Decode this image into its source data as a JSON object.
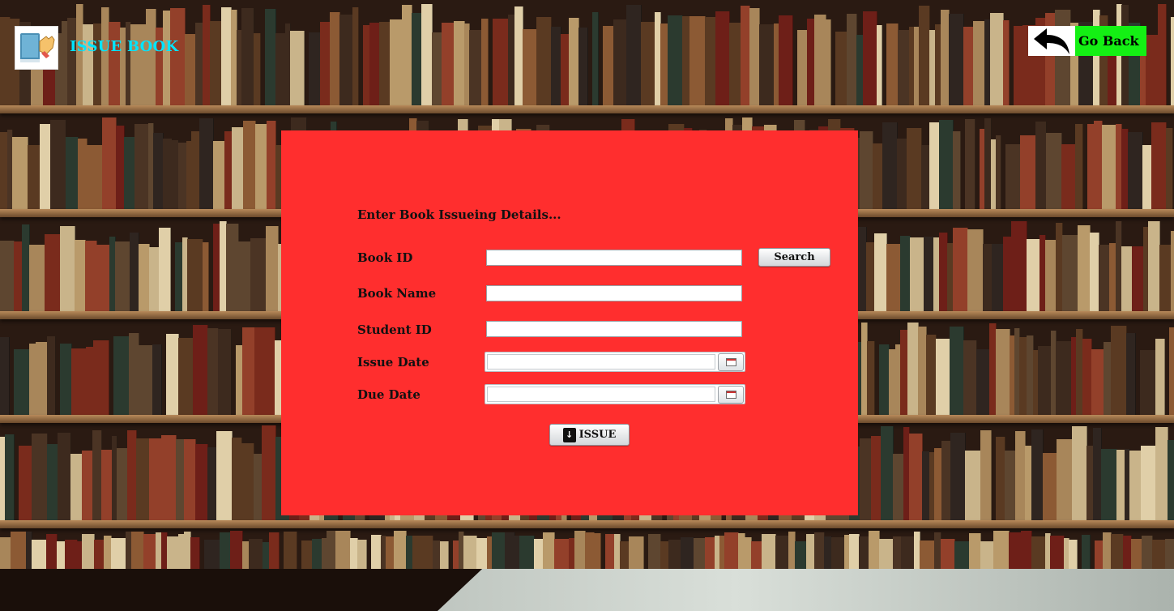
{
  "header": {
    "title": "ISSUE BOOK",
    "logo_icon": "book-hand-icon",
    "go_back_label": "Go Back",
    "go_back_icon": "back-arrow-icon"
  },
  "form": {
    "heading": "Enter Book Issueing Details...",
    "book_id_label": "Book ID",
    "book_id_value": "",
    "search_label": "Search",
    "book_name_label": "Book Name",
    "book_name_value": "",
    "student_id_label": "Student ID",
    "student_id_value": "",
    "issue_date_label": "Issue Date",
    "issue_date_value": "",
    "due_date_label": "Due Date",
    "due_date_value": "",
    "issue_button_label": "ISSUE",
    "calendar_icon": "calendar-icon",
    "issue_icon": "download-book-icon"
  },
  "colors": {
    "panel": "#ff2e2e",
    "title": "#00e5ff",
    "go_back_bg": "#14f014"
  }
}
